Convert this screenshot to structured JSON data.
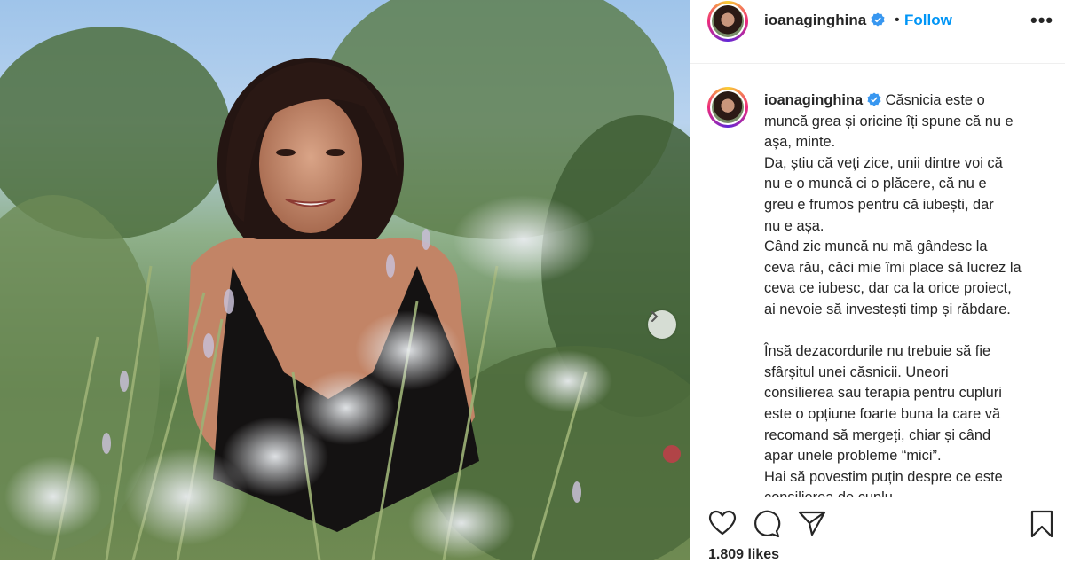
{
  "post": {
    "username": "ioanaginghina",
    "follow_label": "Follow",
    "separator": "•",
    "more_label": "•••",
    "caption_lines": [
      "muncă grea și oricine îți spune că nu e",
      "așa, minte.",
      "Da, știu că veți zice, unii dintre voi că",
      "nu e o muncă ci o plăcere, că nu e",
      "greu e frumos pentru că iubești, dar",
      "nu e așa.",
      "Când zic muncă nu mă gândesc la",
      "ceva rău, căci mie îmi place să lucrez la",
      "ceva ce iubesc, dar ca la orice proiect,",
      "ai nevoie să investești timp și răbdare."
    ],
    "caption_first": "Căsnicia este o",
    "caption_lines_2": [
      "Însă dezacordurile nu trebuie să fie",
      "sfârșitul unei căsnicii. Uneori",
      "consilierea sau terapia pentru cupluri",
      "este o opțiune foarte buna la care vă",
      "recomand să mergeți, chiar și când",
      "apar unele probleme “mici”.",
      "Hai să povestim puțin despre ce este",
      "consilierea de cuplu."
    ],
    "likes": "1.809 likes"
  },
  "icons": {
    "like": "heart-icon",
    "comment": "comment-icon",
    "share": "share-icon",
    "save": "bookmark-icon",
    "verified": "verified-badge-icon",
    "next": "chevron-right-icon"
  },
  "colors": {
    "link": "#0095f6",
    "text": "#262626",
    "border": "#efefef"
  }
}
